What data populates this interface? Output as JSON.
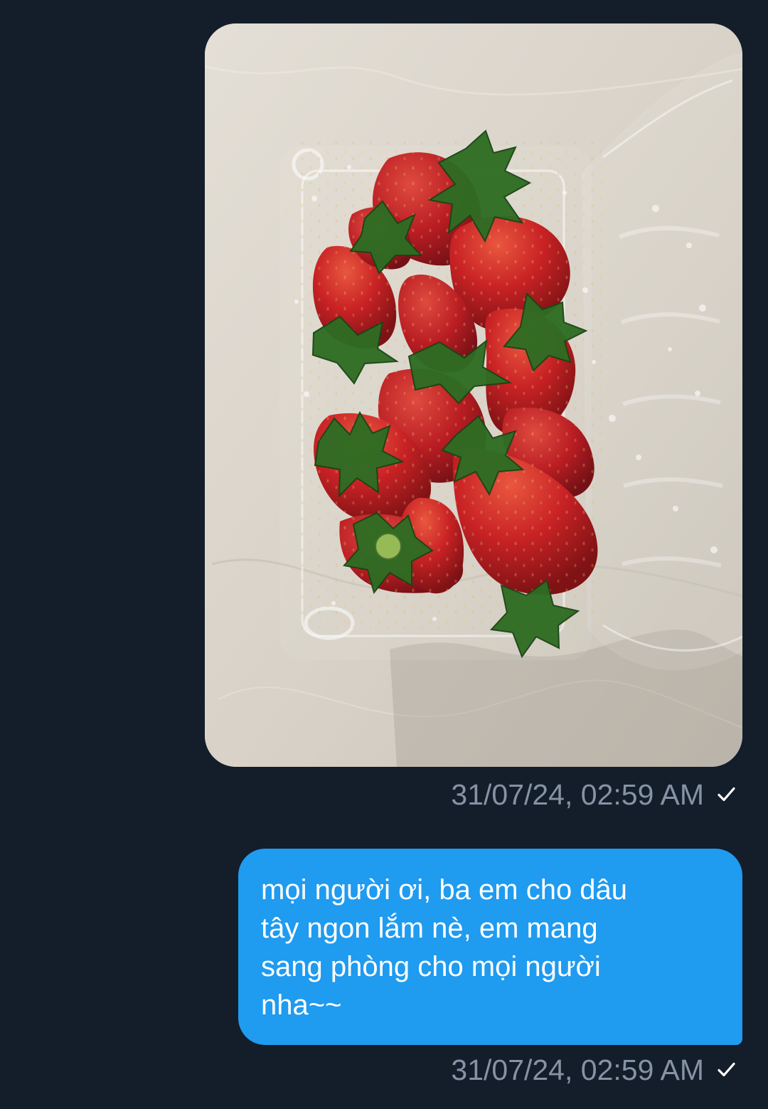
{
  "conversation": {
    "messages": [
      {
        "type": "image",
        "image_subject": "strawberries in clear plastic container",
        "timestamp": "31/07/24, 02:59 AM",
        "status_icon": "single-check-icon"
      },
      {
        "type": "text",
        "text": "mọi người ơi, ba em cho dâu\ntây ngon lắm nè, em mang\nsang phòng cho mọi người\nnha~~",
        "timestamp": "31/07/24, 02:59 AM",
        "status_icon": "single-check-icon"
      }
    ]
  },
  "colors": {
    "background": "#141d2a",
    "outgoing_bubble": "#1f9bf0",
    "timestamp": "#8593a4",
    "message_text": "#ffffff"
  }
}
